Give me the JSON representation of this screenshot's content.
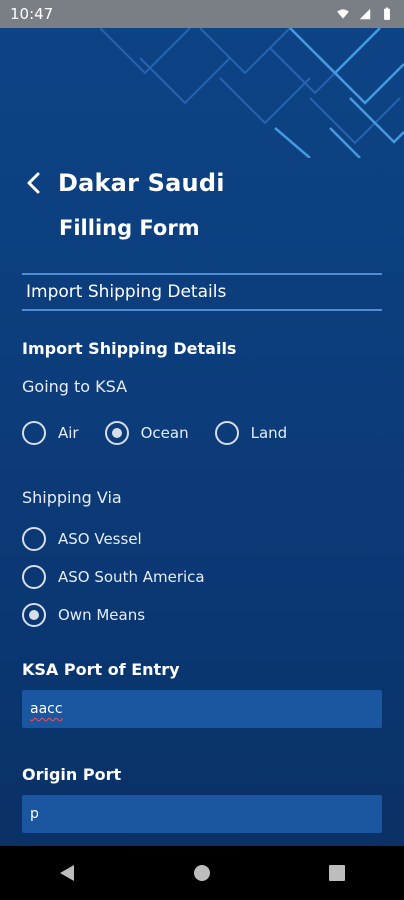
{
  "status": {
    "time": "10:47",
    "icons": [
      "wifi-icon",
      "signal-icon",
      "battery-icon"
    ]
  },
  "header": {
    "title": "Dakar Saudi",
    "subtitle": "Filling Form"
  },
  "section": {
    "title": "Import Shipping Details",
    "heading": "Import Shipping Details"
  },
  "going_to_ksa": {
    "label": "Going to KSA",
    "options": [
      "Air",
      "Ocean",
      "Land"
    ],
    "selected": "Ocean"
  },
  "shipping_via": {
    "label": "Shipping Via",
    "options": [
      "ASO Vessel",
      "ASO South America",
      "Own Means"
    ],
    "selected": "Own Means"
  },
  "ksa_port": {
    "label": "KSA Port of Entry",
    "value": "aacc"
  },
  "origin_port": {
    "label": "Origin Port",
    "value": "p"
  },
  "navigation": {
    "back": "back-icon",
    "home": "home-icon",
    "recents": "recents-icon"
  },
  "colors": {
    "background_top": "#0d4486",
    "field_bg": "#1a57a0",
    "accent_line": "#4f8dd4"
  }
}
